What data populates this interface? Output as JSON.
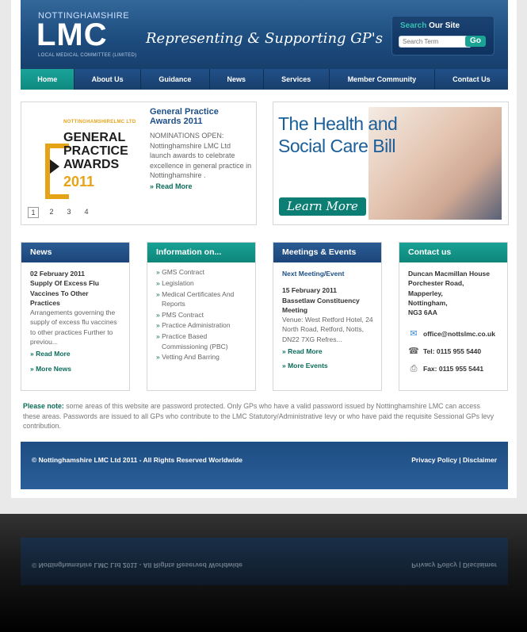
{
  "header": {
    "brand_small": "NOTTINGHAMSHIRE",
    "brand_big": "LMC",
    "brand_sub": "LOCAL MEDICAL COMMITTEE (LIMITED)",
    "tagline": "Representing & Supporting GP's",
    "search": {
      "title_highlight": "Search",
      "title_rest": " Our Site",
      "placeholder": "Search Term",
      "button": "Go"
    }
  },
  "nav": [
    "Home",
    "About Us",
    "Guidance",
    "News",
    "Services",
    "Member Community",
    "Contact Us"
  ],
  "feature": {
    "logo_small": "NOTTINGHAMSHIRELMC LTD",
    "logo_lines": [
      "GENERAL",
      "PRACTICE",
      "AWARDS"
    ],
    "logo_year": "2011",
    "title": "General Practice Awards 2011",
    "text": "NOMINATIONS OPEN: Nottinghamshire LMC Ltd launch awards to celebrate excellence in general practice in Nottinghamshire .",
    "link": "» Read More",
    "pages": [
      "1",
      "2",
      "3",
      "4"
    ]
  },
  "bill": {
    "line1": "The Health and",
    "line2": "Social Care Bill",
    "button": "Learn More"
  },
  "news": {
    "heading": "News",
    "date": "02 February 2011",
    "title": "Supply Of Excess Flu Vaccines To Other Practices",
    "text": "Arrangements governing the supply of excess  flu vaccines to other practices Further to previou...",
    "read_more": "» Read More",
    "more": "» More News"
  },
  "info": {
    "heading": "Information on...",
    "items": [
      "GMS Contract",
      "Legislation",
      "Medical Certificates And Reports",
      "PMS Contract",
      "Practice Administration",
      "Practice Based Commissioning (PBC)",
      "Vetting And Barring"
    ]
  },
  "events": {
    "heading": "Meetings & Events",
    "subheading": "Next Meeting/Event",
    "date": "15 February 2011",
    "title": "Bassetlaw Constituency Meeting",
    "text": "Venue: West Retford Hotel, 24 North Road, Retford, Notts, DN22 7XG Refres...",
    "read_more": "» Read More",
    "more": "» More Events"
  },
  "contact": {
    "heading": "Contact us",
    "address": [
      "Duncan Macmillan House",
      "Porchester Road,",
      "Mapperley,",
      "Nottingham,",
      "NG3 6AA"
    ],
    "email": "office@nottslmc.co.uk",
    "tel": "Tel: 0115 955 5440",
    "fax": "Fax: 0115 955 5441"
  },
  "notice": {
    "label": "Please note:",
    "text": " some areas of this website are password protected. Only GPs who have a valid password issued by Nottinghamshire LMC can access these areas. Passwords are issued to all GPs who contribute to the LMC Statutory/Administrative levy or who have paid the requisite Sessional GPs levy contribution."
  },
  "footer": {
    "copyright": "© Nottinghamshire LMC Ltd 2011 - All Rights Reserved Worldwide",
    "links": "Privacy Policy  |  Disclaimer"
  },
  "colors": {
    "navy": "#1c4b7d",
    "teal": "#0f8a80",
    "link_green": "#0b6b5a",
    "gold": "#e6a317"
  }
}
